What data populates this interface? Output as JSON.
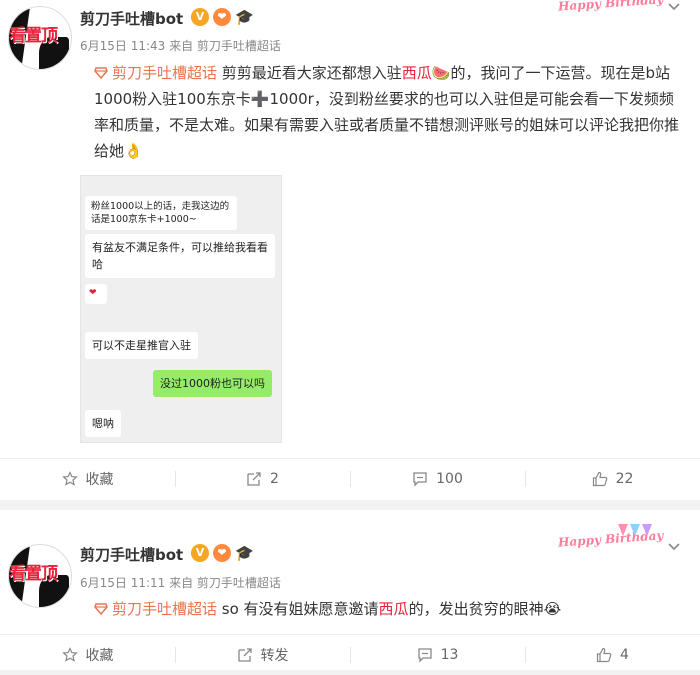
{
  "posts": [
    {
      "author": "剪刀手吐槽bot",
      "avatar_text": "看置顶",
      "meta": "6月15日 11:43 来自 剪刀手吐槽超话",
      "topic": "剪刀手吐槽超话",
      "text_segments": {
        "a": " 剪剪最近看大家还都想入驻",
        "hl": "西瓜",
        "b": "的，我问了一下运营。现在是b站1000粉入驻100东京卡",
        "c": "1000r，没到粉丝要求的也可以入驻但是可能会看一下发频频率和质量，不是太难。如果有需要入驻或者质量不错想测评账号的姐妹可以评论我把你推给她"
      },
      "birthday_text": "Happy Birthday",
      "chat": {
        "msg1": "粉丝1000以上的话，走我这边的话是100京东卡+1000~",
        "msg2": "有盆友不满足条件，可以推给我看看哈",
        "msg4": "可以不走星推官入驻",
        "msg5": "没过1000粉也可以吗",
        "msg6": "嗯呐"
      },
      "actions": {
        "favorite": "收藏",
        "repost": "2",
        "comment": "100",
        "like": "22"
      }
    },
    {
      "author": "剪刀手吐槽bot",
      "avatar_text": "看置顶",
      "meta": "6月15日 11:11 来自 剪刀手吐槽超话",
      "topic": "剪刀手吐槽超话",
      "text_segments": {
        "a": " so 有没有姐妹愿意邀请",
        "hl": "西瓜",
        "b": "的，发出贫穷的眼神"
      },
      "birthday_text": "Happy Birthday",
      "actions": {
        "favorite": "收藏",
        "repost": "转发",
        "comment": "13",
        "like": "4"
      }
    }
  ],
  "colors": {
    "topic": "#eb7350",
    "highlight": "#e8213a",
    "wechat_green": "#95ec69"
  }
}
